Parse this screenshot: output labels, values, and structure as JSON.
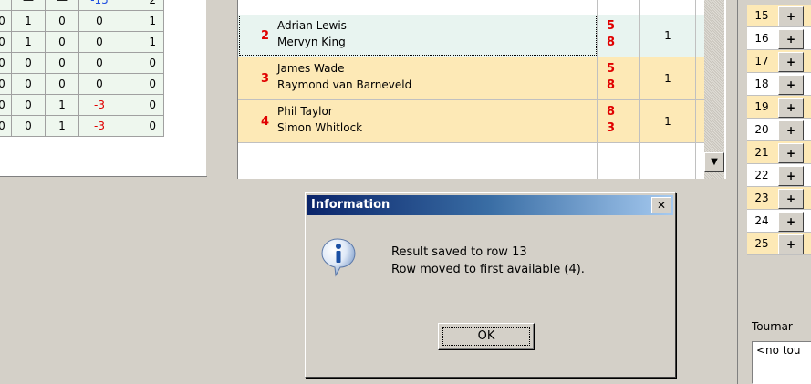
{
  "left_table": {
    "rows": [
      [
        "",
        "—",
        "—",
        "-15",
        "2"
      ],
      [
        "0",
        "1",
        "0",
        "0",
        "1"
      ],
      [
        "0",
        "1",
        "0",
        "0",
        "1"
      ],
      [
        "0",
        "0",
        "0",
        "0",
        "0"
      ],
      [
        "0",
        "0",
        "0",
        "0",
        "0"
      ],
      [
        "0",
        "0",
        "1",
        "-3",
        "0"
      ],
      [
        "0",
        "0",
        "1",
        "-3",
        "0"
      ]
    ]
  },
  "matches": [
    {
      "num": "2",
      "player1": "Adrian Lewis",
      "player2": "Mervyn King",
      "score1": "5",
      "score2": "8",
      "col": "1"
    },
    {
      "num": "3",
      "player1": "James Wade",
      "player2": "Raymond van Barneveld",
      "score1": "5",
      "score2": "8",
      "col": "1"
    },
    {
      "num": "4",
      "player1": "Phil Taylor",
      "player2": "Simon Whitlock",
      "score1": "8",
      "score2": "3",
      "col": "1"
    }
  ],
  "scroll": {
    "down_glyph": "▼"
  },
  "rounds": [
    {
      "num": "15",
      "plus": "+"
    },
    {
      "num": "16",
      "plus": "+"
    },
    {
      "num": "17",
      "plus": "+"
    },
    {
      "num": "18",
      "plus": "+"
    },
    {
      "num": "19",
      "plus": "+"
    },
    {
      "num": "20",
      "plus": "+"
    },
    {
      "num": "21",
      "plus": "+"
    },
    {
      "num": "22",
      "plus": "+"
    },
    {
      "num": "23",
      "plus": "+"
    },
    {
      "num": "24",
      "plus": "+"
    },
    {
      "num": "25",
      "plus": "+"
    }
  ],
  "tournament": {
    "label": "Tournar",
    "value": "<no tou"
  },
  "dialog": {
    "title": "Information",
    "close_glyph": "✕",
    "line1": "Result saved to row 13",
    "line2": "Row moved to first available (4).",
    "ok_label": "OK",
    "icon": "info-icon"
  }
}
